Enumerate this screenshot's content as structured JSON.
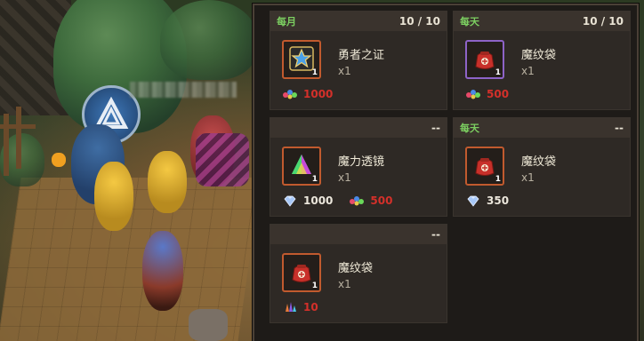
{
  "colors": {
    "period": "#7ccf61",
    "price_red": "#d4302a",
    "price_white": "#ece7dc",
    "border_orange": "#c15a2e",
    "border_purple": "#8d63c7"
  },
  "shop": {
    "cards": [
      {
        "period": "每月",
        "limit": "10 / 10",
        "item": "勇者之证",
        "count": "x1",
        "qty": "1",
        "icon": "star-badge-icon",
        "prices": [
          {
            "currency": "rainbow-gems-icon",
            "amount": "1000",
            "style": "red"
          }
        ]
      },
      {
        "period": "每天",
        "limit": "10 / 10",
        "item": "魔纹袋",
        "count": "x1",
        "qty": "1",
        "icon": "rune-pouch-icon",
        "prices": [
          {
            "currency": "rainbow-gems-icon",
            "amount": "500",
            "style": "red"
          }
        ]
      },
      {
        "period": "",
        "limit": "--",
        "item": "魔力透镜",
        "count": "x1",
        "qty": "1",
        "icon": "prism-icon",
        "prices": [
          {
            "currency": "diamond-icon",
            "amount": "1000",
            "style": "white"
          },
          {
            "currency": "rainbow-gems-icon",
            "amount": "500",
            "style": "red"
          }
        ]
      },
      {
        "period": "每天",
        "limit": "--",
        "item": "魔纹袋",
        "count": "x1",
        "qty": "1",
        "icon": "rune-pouch-icon",
        "prices": [
          {
            "currency": "diamond-icon",
            "amount": "350",
            "style": "white"
          }
        ]
      },
      {
        "period": "",
        "limit": "--",
        "item": "魔纹袋",
        "count": "x1",
        "qty": "1",
        "icon": "rune-pouch-icon",
        "prices": [
          {
            "currency": "gem-shards-icon",
            "amount": "10",
            "style": "red"
          }
        ]
      }
    ]
  }
}
